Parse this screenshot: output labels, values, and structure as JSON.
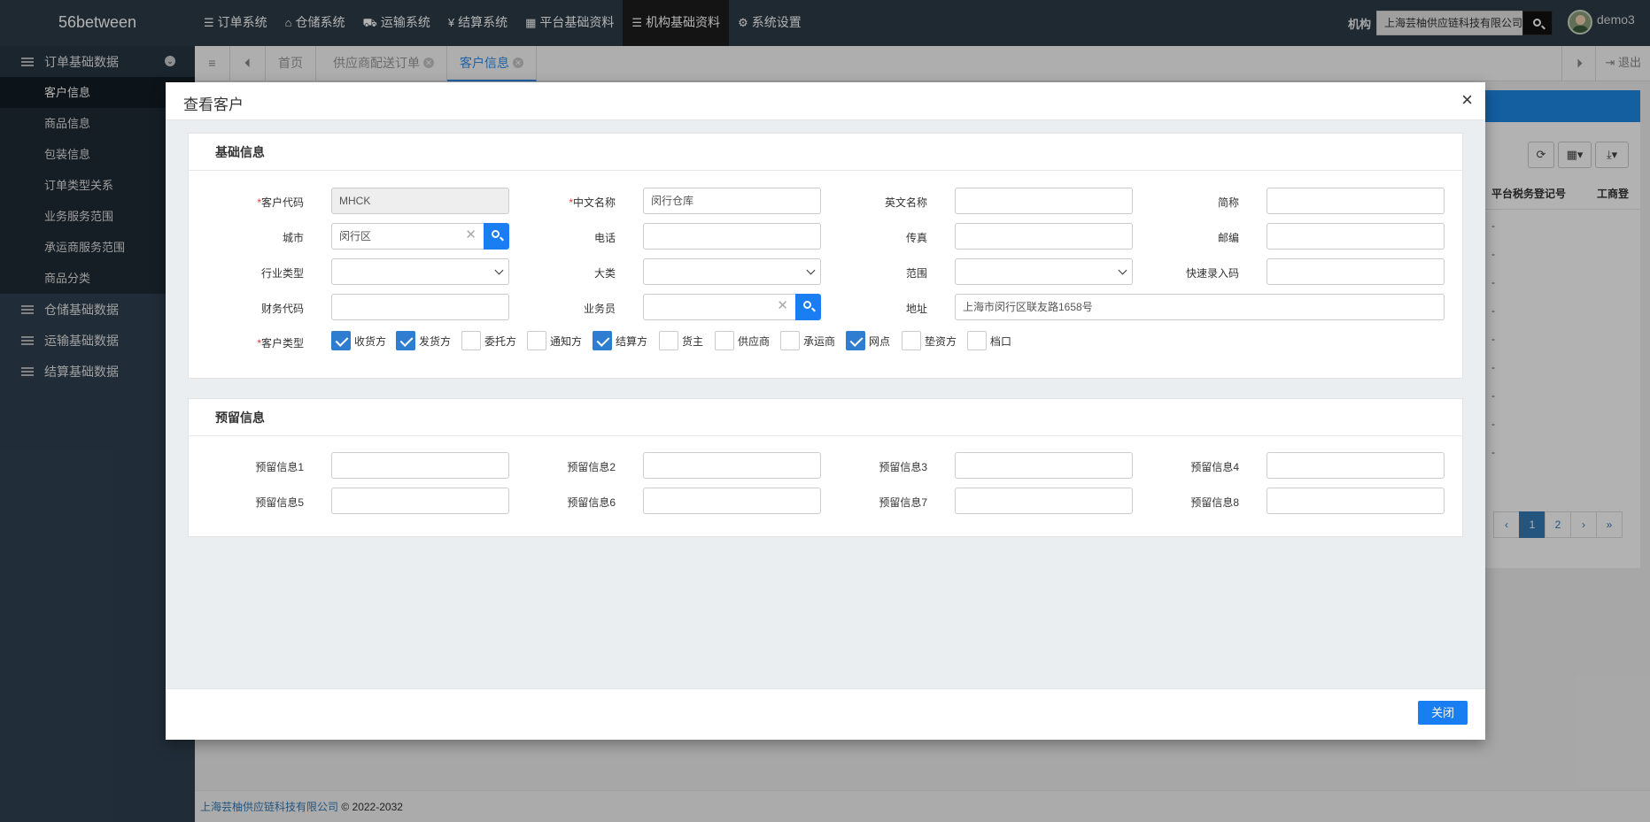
{
  "brand": "56between",
  "topmenu": [
    {
      "label": "订单系统",
      "icon": "list-icon",
      "glyph": "☰"
    },
    {
      "label": "仓储系统",
      "icon": "home-icon",
      "glyph": "⌂"
    },
    {
      "label": "运输系统",
      "icon": "truck-icon",
      "glyph": "⛟"
    },
    {
      "label": "结算系统",
      "icon": "yen-icon",
      "glyph": "¥"
    },
    {
      "label": "平台基础资料",
      "icon": "grid-icon",
      "glyph": "▦"
    },
    {
      "label": "机构基础资料",
      "icon": "list-icon",
      "glyph": "☰"
    },
    {
      "label": "系统设置",
      "icon": "gear-icon",
      "glyph": "⚙"
    }
  ],
  "org": {
    "label": "机构",
    "value": "上海芸柚供应链科技有限公司"
  },
  "user": {
    "name": "demo3"
  },
  "sidebar": {
    "group1": "订单基础数据",
    "items": [
      "客户信息",
      "商品信息",
      "包装信息",
      "订单类型关系",
      "业务服务范围",
      "承运商服务范围",
      "商品分类"
    ],
    "group2": "仓储基础数据",
    "group3": "运输基础数据",
    "group4": "结算基础数据"
  },
  "tabs": [
    "首页",
    "供应商配送订单",
    "客户信息"
  ],
  "logout": "退出",
  "table": {
    "headers": [
      "平台税务登记号",
      "工商登"
    ],
    "rows": [
      "-",
      "-",
      "-",
      "-",
      "-",
      "-",
      "-",
      "-",
      "-"
    ]
  },
  "pager": [
    "‹",
    "1",
    "2",
    "›",
    "»"
  ],
  "footer": {
    "company": "上海芸柚供应链科技有限公司",
    "copyright": "© 2022-2032"
  },
  "modal": {
    "title": "查看客户",
    "close_icon": "×",
    "section1": "基础信息",
    "section2": "预留信息",
    "close_button": "关闭",
    "labels": {
      "code": "客户代码",
      "cn_name": "中文名称",
      "en_name": "英文名称",
      "short": "简称",
      "city": "城市",
      "phone": "电话",
      "fax": "传真",
      "zip": "邮编",
      "industry": "行业类型",
      "category": "大类",
      "scope": "范围",
      "quick": "快速录入码",
      "finance": "财务代码",
      "salesman": "业务员",
      "address": "地址",
      "type": "客户类型"
    },
    "values": {
      "code": "MHCK",
      "cn_name": "闵行仓库",
      "en_name": "",
      "short": "",
      "city": "闵行区",
      "phone": "",
      "fax": "",
      "zip": "",
      "industry": "",
      "category": "",
      "scope": "",
      "quick": "",
      "finance": "",
      "salesman": "",
      "address": "上海市闵行区联友路1658号"
    },
    "customer_types": [
      {
        "label": "收货方",
        "checked": true
      },
      {
        "label": "发货方",
        "checked": true
      },
      {
        "label": "委托方",
        "checked": false
      },
      {
        "label": "通知方",
        "checked": false
      },
      {
        "label": "结算方",
        "checked": true
      },
      {
        "label": "货主",
        "checked": false
      },
      {
        "label": "供应商",
        "checked": false
      },
      {
        "label": "承运商",
        "checked": false
      },
      {
        "label": "网点",
        "checked": true
      },
      {
        "label": "垫资方",
        "checked": false
      },
      {
        "label": "档口",
        "checked": false
      }
    ],
    "reserved": [
      {
        "label": "预留信息1",
        "value": ""
      },
      {
        "label": "预留信息2",
        "value": ""
      },
      {
        "label": "预留信息3",
        "value": ""
      },
      {
        "label": "预留信息4",
        "value": ""
      },
      {
        "label": "预留信息5",
        "value": ""
      },
      {
        "label": "预留信息6",
        "value": ""
      },
      {
        "label": "预留信息7",
        "value": ""
      },
      {
        "label": "预留信息8",
        "value": ""
      }
    ]
  },
  "colors": {
    "nav": "#2c3b48",
    "accent": "#1a7ef3",
    "checkbox": "#2f7dd1",
    "required": "#ee3333"
  }
}
